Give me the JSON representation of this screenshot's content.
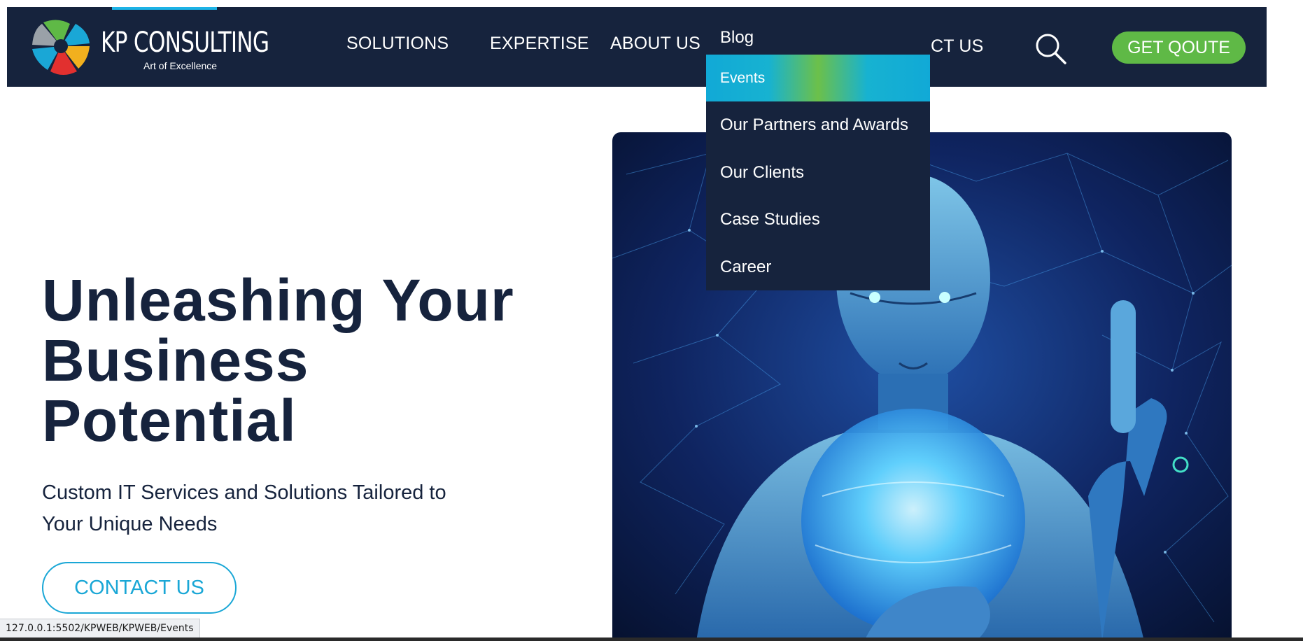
{
  "brand": {
    "name": "KP CONSULTING",
    "tagline": "Art of Excellence"
  },
  "nav": {
    "solutions": "SOLUTIONS",
    "expertise": "EXPERTISE",
    "about": "ABOUT US",
    "contact_partial": "CT US",
    "cta": "GET QOUTE"
  },
  "dropdown": {
    "items": [
      {
        "label": "Blog"
      },
      {
        "label": "Events",
        "active": true
      },
      {
        "label": "Our Partners and Awards"
      },
      {
        "label": "Our Clients"
      },
      {
        "label": "Case Studies"
      },
      {
        "label": "Career"
      }
    ]
  },
  "hero": {
    "title_lines": [
      "Unleashing Your",
      "Business",
      "Potential"
    ],
    "subtitle": "Custom IT Services and Solutions Tailored to Your Unique Needs",
    "button": "CONTACT US"
  },
  "status": {
    "url": "127.0.0.1:5502/KPWEB/KPWEB/Events"
  },
  "colors": {
    "navy": "#16233d",
    "green": "#5fb946",
    "cyan": "#1aa7d6"
  },
  "icons": [
    "logo-mark-icon",
    "search-icon"
  ]
}
